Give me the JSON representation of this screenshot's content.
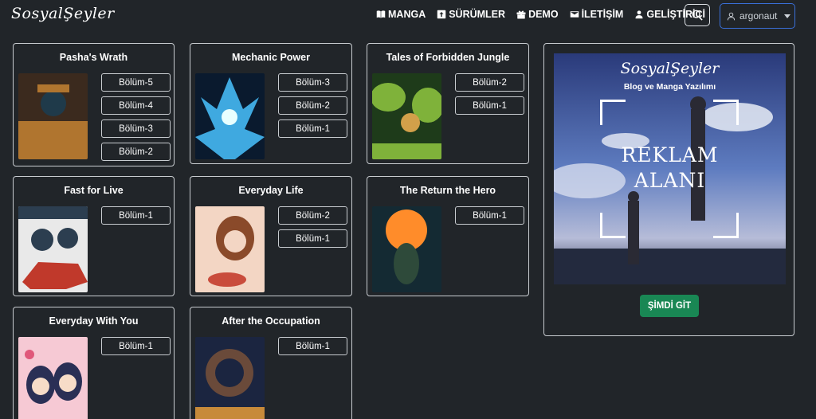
{
  "navbar": {
    "brand": "SosyalŞeyler",
    "links": [
      {
        "label": "MANGA",
        "icon": "book-icon"
      },
      {
        "label": "SÜRÜMLER",
        "icon": "upload-icon"
      },
      {
        "label": "DEMO",
        "icon": "gift-icon"
      },
      {
        "label": "İLETİŞİM",
        "icon": "envelope-icon"
      },
      {
        "label": "GELİŞTİRİCİ",
        "icon": "person-icon"
      }
    ],
    "search_icon": "search-icon",
    "user": "argonaut"
  },
  "mangas": [
    {
      "title": "Pasha's Wrath",
      "chapters": [
        "Bölüm-5",
        "Bölüm-4",
        "Bölüm-3",
        "Bölüm-2"
      ],
      "cover_colors": [
        "#3b2a1e",
        "#b0752f",
        "#1f3a4a"
      ]
    },
    {
      "title": "Mechanic Power",
      "chapters": [
        "Bölüm-3",
        "Bölüm-2",
        "Bölüm-1"
      ],
      "cover_colors": [
        "#0a1a2e",
        "#3fa9e0",
        "#e8ffff"
      ]
    },
    {
      "title": "Tales of Forbidden Jungle",
      "chapters": [
        "Bölüm-2",
        "Bölüm-1"
      ],
      "cover_colors": [
        "#1e3b1a",
        "#7fb23a",
        "#d2a04a"
      ]
    },
    {
      "title": "Fast for Live",
      "chapters": [
        "Bölüm-1"
      ],
      "cover_colors": [
        "#e9e9e9",
        "#c0392b",
        "#2c3e50"
      ]
    },
    {
      "title": "Everyday Life",
      "chapters": [
        "Bölüm-2",
        "Bölüm-1"
      ],
      "cover_colors": [
        "#f3d6c4",
        "#8a4a2a",
        "#c94c3c"
      ]
    },
    {
      "title": "The Return the Hero",
      "chapters": [
        "Bölüm-1"
      ],
      "cover_colors": [
        "#ff8c2a",
        "#2e4a3a",
        "#142a33"
      ]
    },
    {
      "title": "Everyday With You",
      "chapters": [
        "Bölüm-1"
      ],
      "cover_colors": [
        "#f6c9d4",
        "#2a2f55",
        "#e0587a"
      ]
    },
    {
      "title": "After the Occupation",
      "chapters": [
        "Bölüm-1"
      ],
      "cover_colors": [
        "#1b2540",
        "#6a4a3a",
        "#c78a3a"
      ]
    }
  ],
  "ad": {
    "brand": "SosyalŞeyler",
    "subtitle": "Blog ve Manga Yazılımı",
    "line1": "REKLAM",
    "line2": "ALANI",
    "button": "ŞİMDİ GİT"
  },
  "colors": {
    "background": "#212529",
    "accent_button": "#198754",
    "user_border": "#3a6fd8"
  }
}
